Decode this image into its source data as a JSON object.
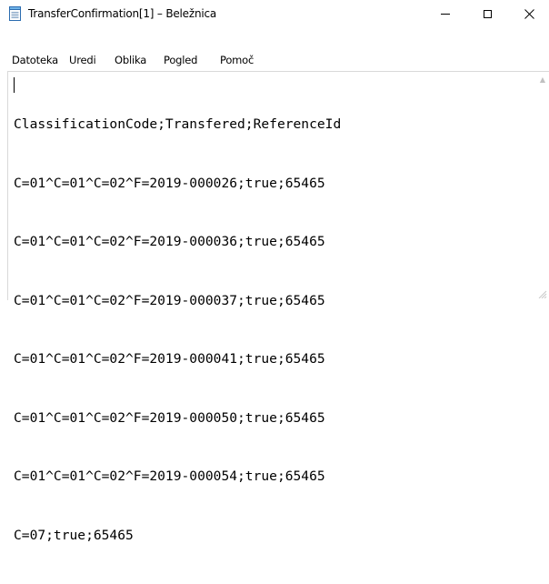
{
  "window": {
    "title": "TransferConfirmation[1] – Beležnica",
    "icon": "notepad-icon",
    "controls": {
      "minimize_icon": "minimize-icon",
      "maximize_icon": "maximize-icon",
      "close_label": "✕"
    }
  },
  "menu": {
    "items": [
      "Datoteka",
      "Uredi",
      "Oblika",
      "Pogled",
      "Pomoč"
    ]
  },
  "document": {
    "lines": [
      "ClassificationCode;Transfered;ReferenceId",
      "C=01^C=01^C=02^F=2019-000026;true;65465",
      "C=01^C=01^C=02^F=2019-000036;true;65465",
      "C=01^C=01^C=02^F=2019-000037;true;65465",
      "C=01^C=01^C=02^F=2019-000041;true;65465",
      "C=01^C=01^C=02^F=2019-000050;true;65465",
      "C=01^C=01^C=02^F=2019-000054;true;65465",
      "C=07;true;65465"
    ]
  },
  "scrollbar": {
    "up_arrow": "▲"
  }
}
